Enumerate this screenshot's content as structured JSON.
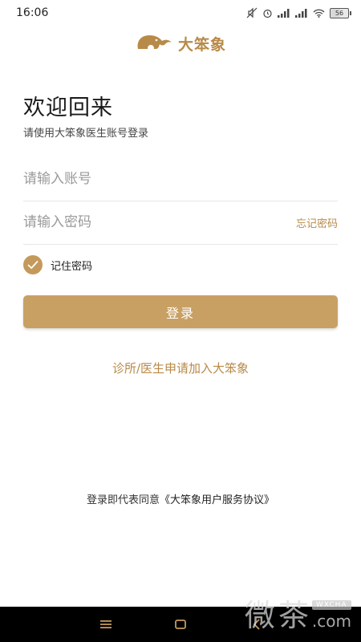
{
  "status_bar": {
    "time": "16:06",
    "battery": "56",
    "battery_level": 0.56
  },
  "logo": {
    "text": "大笨象",
    "icon": "elephant-logo-icon"
  },
  "login": {
    "title": "欢迎回来",
    "subtitle": "请使用大笨象医生账号登录",
    "account_placeholder": "请输入账号",
    "password_placeholder": "请输入密码",
    "forgot_password": "忘记密码",
    "remember_label": "记住密码",
    "remember_checked": true,
    "login_button": "登录",
    "join_link": "诊所/医生申请加入大笨象",
    "agreement_prefix": "登录即代表同意",
    "agreement_link": "《大笨象用户服务协议》"
  },
  "watermark": {
    "char1": "微",
    "char2": "茶",
    "badge": "WXCHA",
    "com": ".com"
  },
  "colors": {
    "accent": "#c9a064",
    "accent_text": "#b88a48",
    "nav_bar": "#000000"
  }
}
